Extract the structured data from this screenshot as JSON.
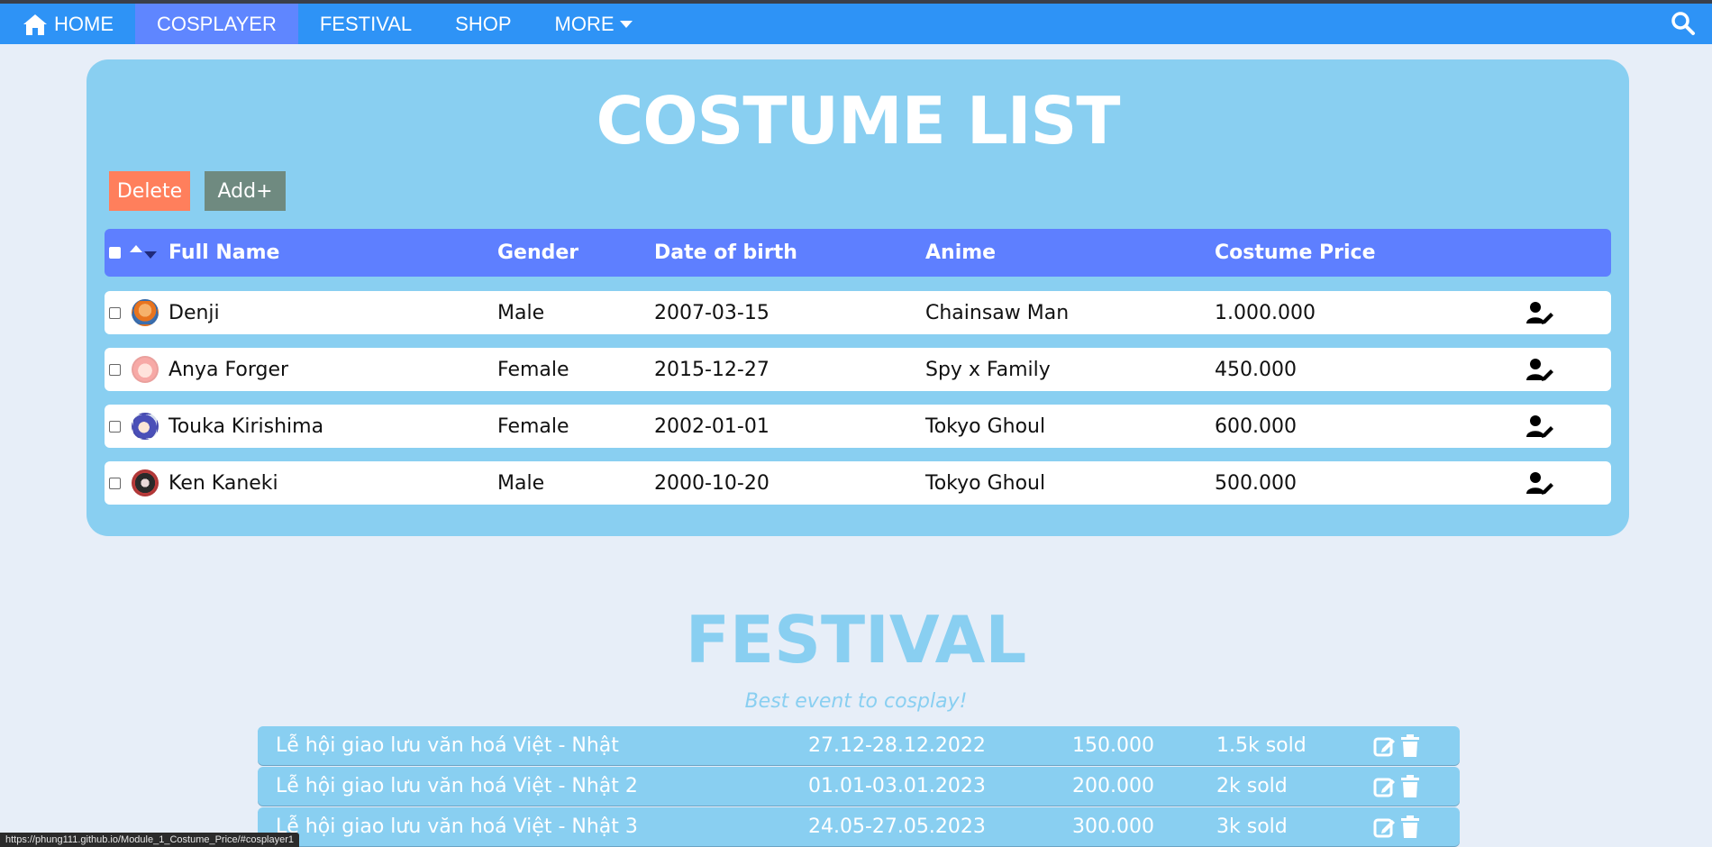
{
  "nav": {
    "home": "HOME",
    "cosplayer": "COSPLAYER",
    "festival": "FESTIVAL",
    "shop": "SHOP",
    "more": "MORE",
    "icons": [
      "home-icon",
      "caret-down-icon",
      "search-icon"
    ],
    "colors": {
      "bar": "#2e93f6",
      "active": "#5f86ff"
    }
  },
  "costume": {
    "title": "COSTUME LIST",
    "delete_label": "Delete",
    "add_label": "Add+",
    "headers": {
      "full_name": "Full Name",
      "gender": "Gender",
      "dob": "Date of birth",
      "anime": "Anime",
      "price": "Costume Price"
    },
    "rows": [
      {
        "name": "Denji",
        "gender": "Male",
        "dob": "2007-03-15",
        "anime": "Chainsaw Man",
        "price": "1.000.000"
      },
      {
        "name": "Anya Forger",
        "gender": "Female",
        "dob": "2015-12-27",
        "anime": "Spy x Family",
        "price": "450.000"
      },
      {
        "name": "Touka Kirishima",
        "gender": "Female",
        "dob": "2002-01-01",
        "anime": "Tokyo Ghoul",
        "price": "600.000"
      },
      {
        "name": "Ken Kaneki",
        "gender": "Male",
        "dob": "2000-10-20",
        "anime": "Tokyo Ghoul",
        "price": "500.000"
      }
    ],
    "colors": {
      "panel": "#89cff1",
      "header": "#5e7fff",
      "delete": "#ff7f5c",
      "add": "#6f8a80"
    }
  },
  "festival": {
    "title": "FESTIVAL",
    "subtitle": "Best event to cosplay!",
    "rows": [
      {
        "name": "Lễ hội giao lưu văn hoá Việt - Nhật",
        "date": "27.12-28.12.2022",
        "price": "150.000",
        "sold": "1.5k sold"
      },
      {
        "name": "Lễ hội giao lưu văn hoá Việt - Nhật 2",
        "date": "01.01-03.01.2023",
        "price": "200.000",
        "sold": "2k sold"
      },
      {
        "name": "Lễ hội giao lưu văn hoá Việt - Nhật 3",
        "date": "24.05-27.05.2023",
        "price": "300.000",
        "sold": "3k sold"
      }
    ]
  },
  "status_url": "https://phung111.github.io/Module_1_Costume_Price/#cosplayer1"
}
